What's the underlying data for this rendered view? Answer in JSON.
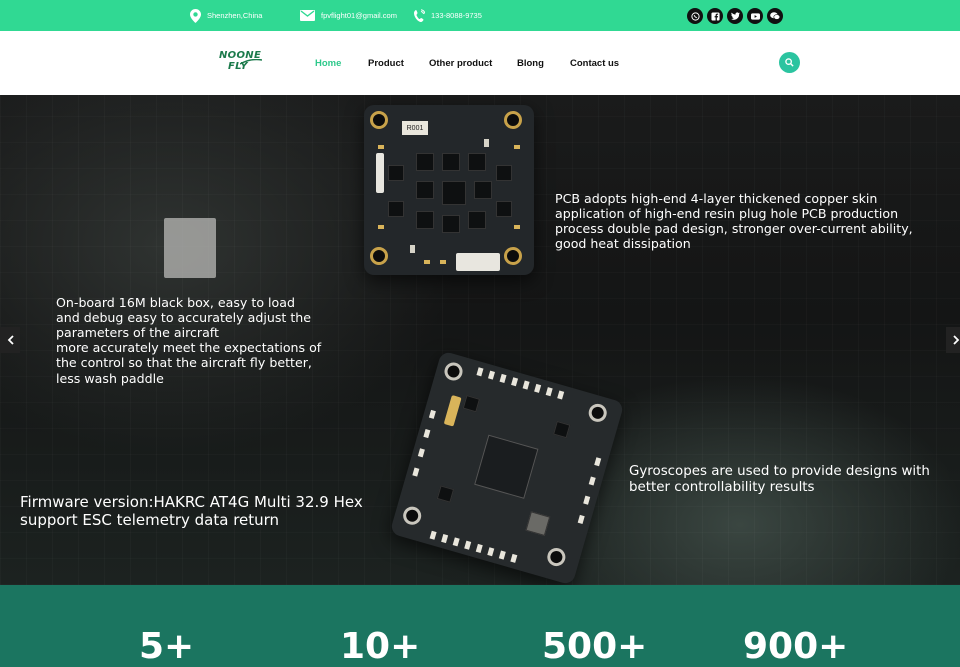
{
  "topbar": {
    "location": "Shenzhen,China",
    "email": "fpvflight01@gmail.com",
    "phone": "133-8088-9735",
    "socials": [
      "whatsapp-icon",
      "facebook-icon",
      "twitter-icon",
      "youtube-icon",
      "wechat-icon"
    ]
  },
  "header": {
    "logo_line1": "NOONE",
    "logo_line2": "FLY",
    "nav": [
      "Home",
      "Product",
      "Other product",
      "Blong",
      "Contact us"
    ],
    "active_nav": "Home"
  },
  "hero": {
    "text_pcb": "PCB adopts high-end 4-layer thickened copper skin\napplication of high-end resin plug hole PCB production\nprocess double pad design, stronger over-current ability,\n good heat dissipation",
    "text_blackbox": "On-board 16M black box, easy to load\nand debug easy to accurately adjust the\nparameters of the aircraft\nmore accurately meet the expectations of\nthe control so that the aircraft fly better,\nless wash paddle",
    "text_firmware": "Firmware version:HAKRC AT4G Multi 32.9 Hex\nsupport ESC telemetry data return",
    "text_gyro": "Gyroscopes are used to provide designs with\nbetter controllability results",
    "board_label": "R001"
  },
  "stats": [
    "5+",
    "10+",
    "500+",
    "900+"
  ],
  "colors": {
    "topbar": "#30d993",
    "accent": "#2ec98c",
    "stats_bg": "#1b7560",
    "logo": "#1b7a4b"
  }
}
